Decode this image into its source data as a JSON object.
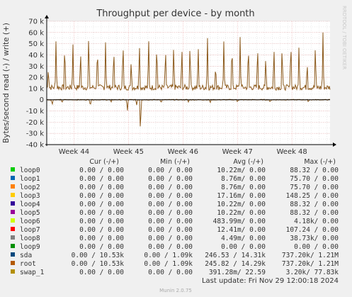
{
  "title": "Throughput per device - by month",
  "watermark": "RRDTOOL / TOBI OETIKER",
  "footer": {
    "last_update": "Last update: Fri Nov 29 12:00:18 2024",
    "version": "Munin 2.0.75"
  },
  "colors": {
    "background": "#f0f0f0",
    "canvas": "#ffffff",
    "major_grid": "#e8a0a0",
    "minor_grid": "#d8d8d8",
    "series_line": "#8c5a1c",
    "zero_line": "#000000"
  },
  "chart_data": {
    "type": "line",
    "title": "Throughput per device - by month",
    "ylabel": "Bytes/second read (-) / write (+)",
    "ylim": [
      -40000,
      70000
    ],
    "y_ticks": [
      {
        "value": 70000,
        "label": "70 k"
      },
      {
        "value": 60000,
        "label": "60 k"
      },
      {
        "value": 50000,
        "label": "50 k"
      },
      {
        "value": 40000,
        "label": "40 k"
      },
      {
        "value": 30000,
        "label": "30 k"
      },
      {
        "value": 20000,
        "label": "20 k"
      },
      {
        "value": 10000,
        "label": "10 k"
      },
      {
        "value": 0,
        "label": "0"
      },
      {
        "value": -10000,
        "label": "-10 k"
      },
      {
        "value": -20000,
        "label": "-20 k"
      },
      {
        "value": -30000,
        "label": "-30 k"
      },
      {
        "value": -40000,
        "label": "-40 k"
      }
    ],
    "x_range": [
      43.5,
      48.7
    ],
    "x_ticks": [
      {
        "value": 44,
        "label": "Week 44"
      },
      {
        "value": 45,
        "label": "Week 45"
      },
      {
        "value": 46,
        "label": "Week 46"
      },
      {
        "value": 47,
        "label": "Week 47"
      },
      {
        "value": 48,
        "label": "Week 48"
      }
    ],
    "grid": true,
    "series": [
      {
        "name": "root",
        "color": "#8c5a1c",
        "write": {
          "base": 11000,
          "spikes": [
            [
              43.53,
              30000
            ],
            [
              43.67,
              55000
            ],
            [
              43.83,
              53000
            ],
            [
              43.98,
              52000
            ],
            [
              44.12,
              48000
            ],
            [
              44.27,
              62000
            ],
            [
              44.43,
              52000
            ],
            [
              44.58,
              54000
            ],
            [
              44.73,
              50000
            ],
            [
              44.9,
              55000
            ],
            [
              45.05,
              37000
            ],
            [
              45.2,
              55000
            ],
            [
              45.37,
              58000
            ],
            [
              45.52,
              54000
            ],
            [
              45.68,
              50000
            ],
            [
              45.83,
              52000
            ],
            [
              45.98,
              50000
            ],
            [
              46.13,
              55000
            ],
            [
              46.28,
              50000
            ],
            [
              46.45,
              58000
            ],
            [
              46.6,
              34000
            ],
            [
              46.75,
              52000
            ],
            [
              46.9,
              53000
            ],
            [
              47.05,
              59000
            ],
            [
              47.2,
              52000
            ],
            [
              47.37,
              52000
            ],
            [
              47.52,
              40000
            ],
            [
              47.67,
              50000
            ],
            [
              47.82,
              52000
            ],
            [
              47.98,
              58000
            ],
            [
              48.13,
              52000
            ],
            [
              48.28,
              36000
            ],
            [
              48.43,
              52000
            ],
            [
              48.57,
              60000
            ]
          ]
        },
        "read": {
          "base": 0,
          "spikes": [
            [
              43.6,
              -5000
            ],
            [
              43.78,
              -3000
            ],
            [
              44.3,
              -6000
            ],
            [
              44.68,
              -2500
            ],
            [
              44.98,
              -11000
            ],
            [
              45.15,
              -5000
            ],
            [
              45.22,
              -32000
            ],
            [
              45.6,
              -3000
            ],
            [
              46.1,
              -2000
            ],
            [
              46.5,
              -3000
            ],
            [
              47.0,
              -2000
            ],
            [
              47.6,
              -2500
            ],
            [
              48.3,
              -2000
            ]
          ]
        }
      }
    ]
  },
  "legend": {
    "headers": {
      "cur": "Cur (-/+)",
      "min": "Min (-/+)",
      "avg": "Avg (-/+)",
      "max": "Max (-/+)"
    },
    "rows": [
      {
        "name": "loop0",
        "color": "#00cc00",
        "cur": "0.00 /  0.00",
        "min": "0.00 /  0.00",
        "avg": "10.22m/  0.00",
        "max": "88.32 /  0.00"
      },
      {
        "name": "loop1",
        "color": "#0066b3",
        "cur": "0.00 /  0.00",
        "min": "0.00 /  0.00",
        "avg": "8.76m/  0.00",
        "max": "75.70 /  0.00"
      },
      {
        "name": "loop2",
        "color": "#ff8000",
        "cur": "0.00 /  0.00",
        "min": "0.00 /  0.00",
        "avg": "8.76m/  0.00",
        "max": "75.70 /  0.00"
      },
      {
        "name": "loop3",
        "color": "#ffcc00",
        "cur": "0.00 /  0.00",
        "min": "0.00 /  0.00",
        "avg": "17.16m/  0.00",
        "max": "148.25 /  0.00"
      },
      {
        "name": "loop4",
        "color": "#330099",
        "cur": "0.00 /  0.00",
        "min": "0.00 /  0.00",
        "avg": "10.22m/  0.00",
        "max": "88.32 /  0.00"
      },
      {
        "name": "loop5",
        "color": "#990099",
        "cur": "0.00 /  0.00",
        "min": "0.00 /  0.00",
        "avg": "10.22m/  0.00",
        "max": "88.32 /  0.00"
      },
      {
        "name": "loop6",
        "color": "#ccff00",
        "cur": "0.00 /  0.00",
        "min": "0.00 /  0.00",
        "avg": "483.99m/  0.00",
        "max": "4.18k/  0.00"
      },
      {
        "name": "loop7",
        "color": "#ff0000",
        "cur": "0.00 /  0.00",
        "min": "0.00 /  0.00",
        "avg": "12.41m/  0.00",
        "max": "107.24 /  0.00"
      },
      {
        "name": "loop8",
        "color": "#808080",
        "cur": "0.00 /  0.00",
        "min": "0.00 /  0.00",
        "avg": "4.49m/  0.00",
        "max": "38.73k/  0.00"
      },
      {
        "name": "loop9",
        "color": "#008f00",
        "cur": "0.00 /  0.00",
        "min": "0.00 /  0.00",
        "avg": "0.00 /  0.00",
        "max": "0.00 /  0.00"
      },
      {
        "name": "sda",
        "color": "#00487d",
        "cur": "0.00 / 10.53k",
        "min": "0.00 /  1.09k",
        "avg": "246.53 / 14.31k",
        "max": "737.20k/  1.21M"
      },
      {
        "name": "root",
        "color": "#b35a00",
        "cur": "0.00 / 10.53k",
        "min": "0.00 /  1.09k",
        "avg": "245.82 / 14.29k",
        "max": "737.20k/  1.21M"
      },
      {
        "name": "swap_1",
        "color": "#b38f00",
        "cur": "0.00 /  0.00",
        "min": "0.00 /  0.00",
        "avg": "391.28m/ 22.59",
        "max": "3.20k/ 77.83k"
      }
    ]
  }
}
